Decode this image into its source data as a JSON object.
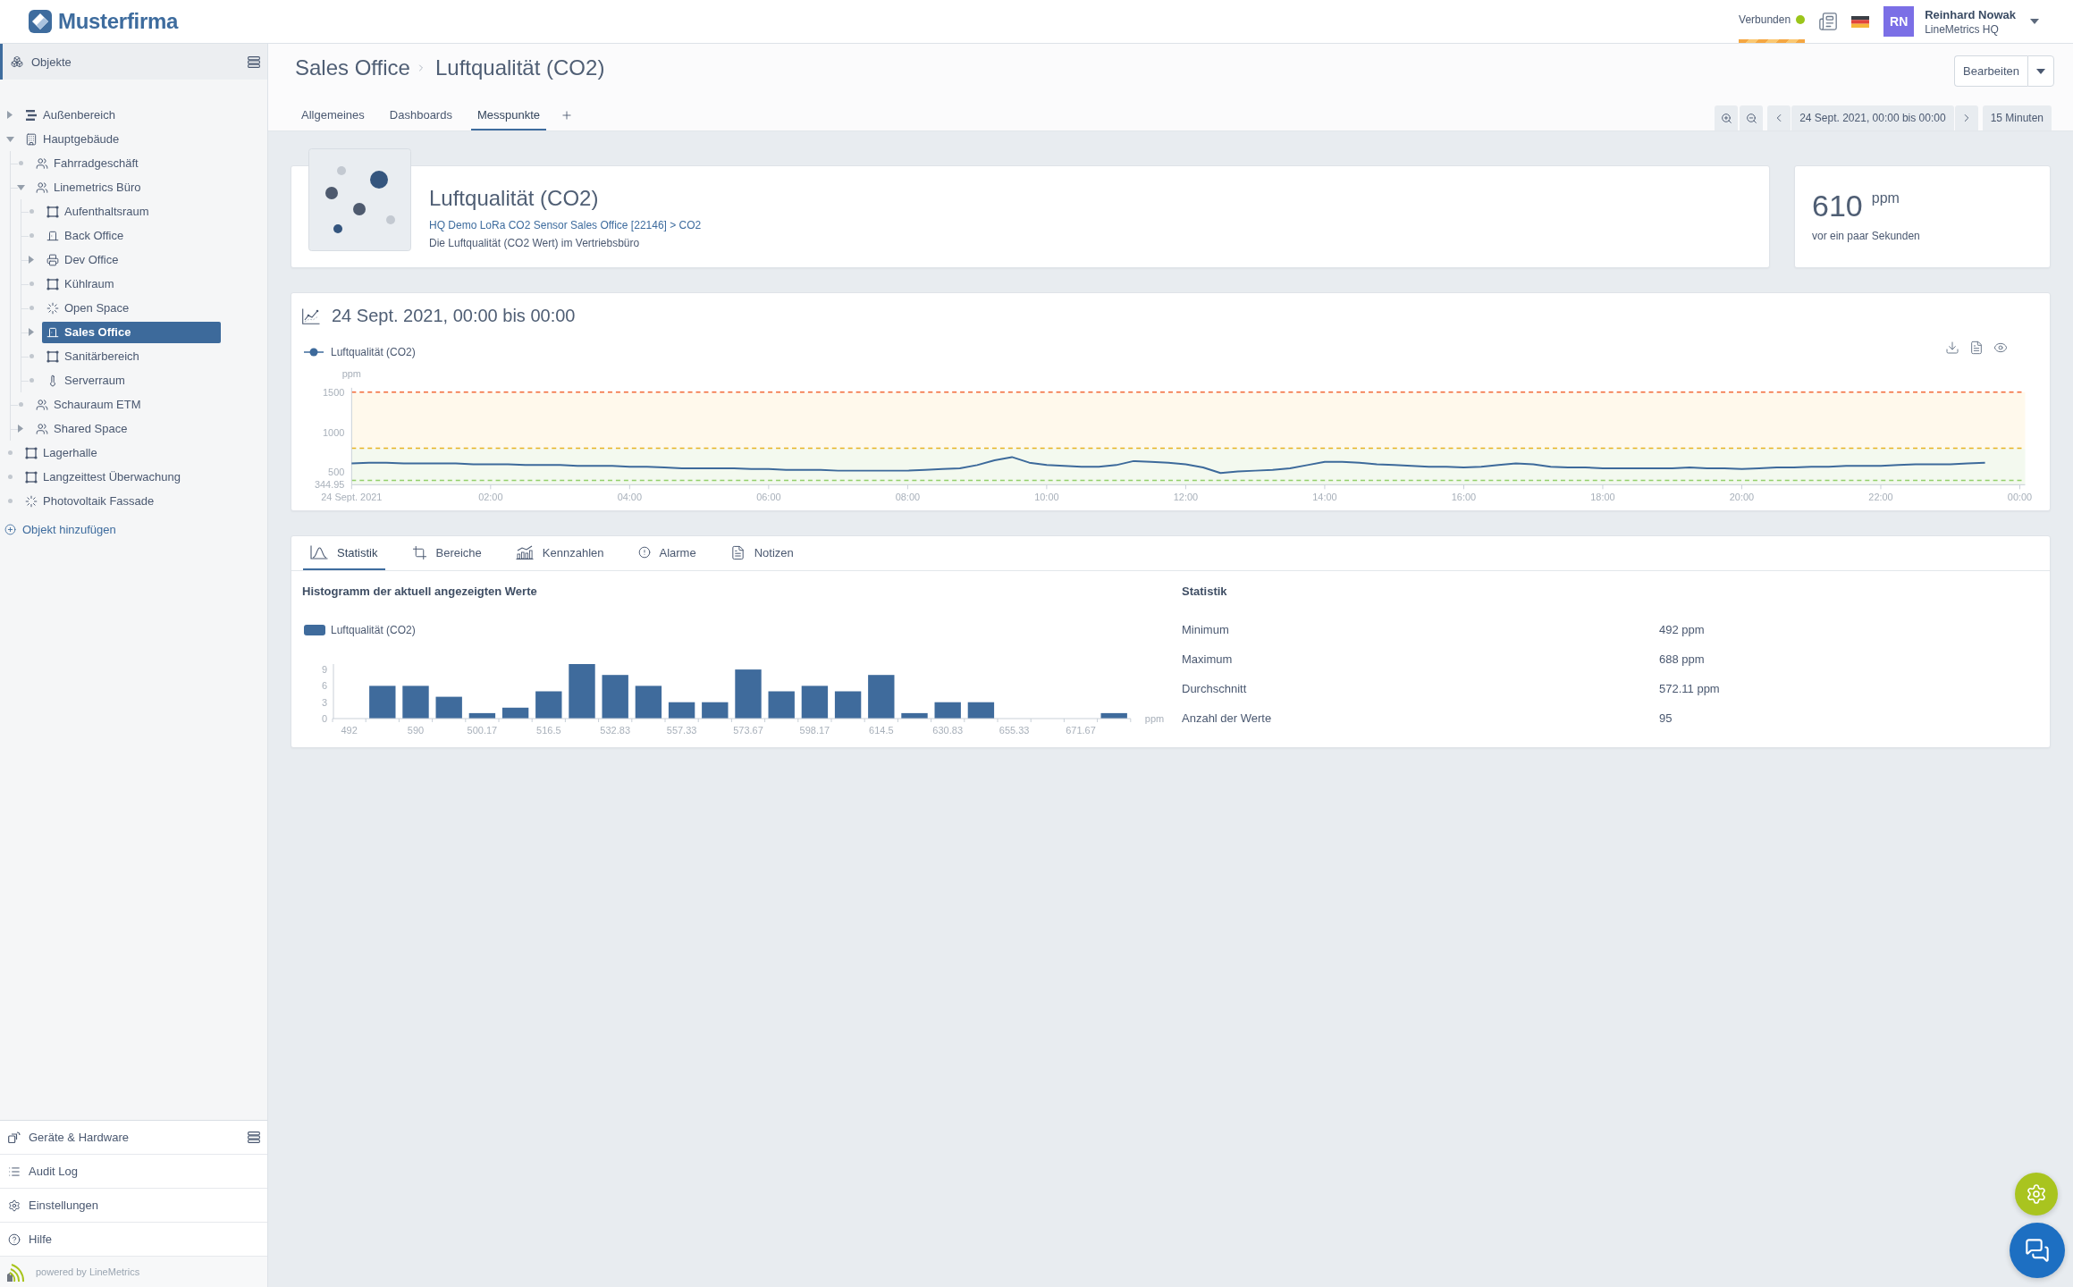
{
  "topbar": {
    "logo": "Musterfirma",
    "status": {
      "label": "Verbunden",
      "connected": true
    },
    "user": {
      "initials": "RN",
      "name": "Reinhard Nowak",
      "org": "LineMetrics HQ"
    }
  },
  "sidebar": {
    "section": "Objekte",
    "tree": [
      {
        "label": "Außenbereich",
        "kind": "zone",
        "leaf": false,
        "expanded": false,
        "selected": false
      },
      {
        "label": "Hauptgebäude",
        "kind": "building",
        "leaf": false,
        "expanded": true,
        "selected": false,
        "children": [
          {
            "label": "Fahrradgeschäft",
            "kind": "team",
            "leaf": true,
            "expanded": false,
            "selected": false
          },
          {
            "label": "Linemetrics Büro",
            "kind": "team",
            "leaf": false,
            "expanded": true,
            "selected": false,
            "children": [
              {
                "label": "Aufenthaltsraum",
                "kind": "room",
                "leaf": true,
                "expanded": false,
                "selected": false
              },
              {
                "label": "Back Office",
                "kind": "door",
                "leaf": true,
                "expanded": false,
                "selected": false
              },
              {
                "label": "Dev Office",
                "kind": "machine",
                "leaf": false,
                "expanded": false,
                "selected": false
              },
              {
                "label": "Kühlraum",
                "kind": "room",
                "leaf": true,
                "expanded": false,
                "selected": false
              },
              {
                "label": "Open Space",
                "kind": "sun",
                "leaf": true,
                "expanded": false,
                "selected": false
              },
              {
                "label": "Sales Office",
                "kind": "door",
                "leaf": false,
                "expanded": false,
                "selected": true
              },
              {
                "label": "Sanitärbereich",
                "kind": "room",
                "leaf": true,
                "expanded": false,
                "selected": false
              },
              {
                "label": "Serverraum",
                "kind": "thermometer",
                "leaf": true,
                "expanded": false,
                "selected": false
              }
            ]
          },
          {
            "label": "Schauraum ETM",
            "kind": "team",
            "leaf": true,
            "expanded": false,
            "selected": false
          },
          {
            "label": "Shared Space",
            "kind": "team",
            "leaf": false,
            "expanded": false,
            "selected": false
          }
        ]
      },
      {
        "label": "Lagerhalle",
        "kind": "room",
        "leaf": true,
        "expanded": false,
        "selected": false
      },
      {
        "label": "Langzeittest Überwachung",
        "kind": "room",
        "leaf": true,
        "expanded": false,
        "selected": false
      },
      {
        "label": "Photovoltaik Fassade",
        "kind": "sun",
        "leaf": true,
        "expanded": false,
        "selected": false
      }
    ],
    "add_label": "Objekt hinzufügen",
    "nav": [
      {
        "kind": "devices",
        "label": "Geräte & Hardware",
        "menu": true
      },
      {
        "kind": "log",
        "label": "Audit Log",
        "menu": false
      },
      {
        "kind": "settings",
        "label": "Einstellungen",
        "menu": false
      },
      {
        "kind": "help",
        "label": "Hilfe",
        "menu": false
      }
    ],
    "footer": "powered by LineMetrics"
  },
  "page": {
    "breadcrumb": {
      "parent": "Sales Office",
      "current": "Luftqualität (CO2)"
    },
    "edit_button": "Bearbeiten",
    "tabs": [
      {
        "label": "Allgemeines",
        "selected": false
      },
      {
        "label": "Dashboards",
        "selected": false
      },
      {
        "label": "Messpunkte",
        "selected": true
      }
    ],
    "timebar": {
      "range": "24 Sept. 2021, 00:00 bis 00:00",
      "interval": "15 Minuten"
    }
  },
  "datapoint": {
    "title": "Luftqualität (CO2)",
    "source": "HQ Demo LoRa CO2 Sensor Sales Office [22146] > CO2",
    "description": "Die Luftqualität (CO2 Wert) im Vertriebsbüro"
  },
  "current_value": {
    "value": "610",
    "unit": "ppm",
    "age": "vor ein paar Sekunden"
  },
  "trend": {
    "chart_data": {
      "type": "line",
      "title": "24 Sept. 2021, 00:00 bis 00:00",
      "ylabel": "ppm",
      "x": [
        0,
        0.25,
        0.5,
        0.75,
        1,
        1.25,
        1.5,
        1.75,
        2,
        2.25,
        2.5,
        2.75,
        3,
        3.25,
        3.5,
        3.75,
        4,
        4.25,
        4.5,
        4.75,
        5,
        5.25,
        5.5,
        5.75,
        6,
        6.25,
        6.5,
        6.75,
        7,
        7.25,
        7.5,
        7.75,
        8,
        8.25,
        8.5,
        8.75,
        9,
        9.25,
        9.5,
        9.75,
        10,
        10.25,
        10.5,
        10.75,
        11,
        11.25,
        11.5,
        11.75,
        12,
        12.25,
        12.5,
        12.75,
        13,
        13.25,
        13.5,
        13.75,
        14,
        14.25,
        14.5,
        14.75,
        15,
        15.25,
        15.5,
        15.75,
        16,
        16.25,
        16.5,
        16.75,
        17,
        17.25,
        17.5,
        17.75,
        18,
        18.25,
        18.5,
        18.75,
        19,
        19.25,
        19.5,
        19.75,
        20,
        20.25,
        20.5,
        20.75,
        21,
        21.25,
        21.5,
        21.75,
        22,
        22.25,
        22.5,
        22.75,
        23,
        23.25,
        23.5
      ],
      "series": [
        {
          "name": "Luftqualität (CO2)",
          "color": "#3d6a9b",
          "values": [
            610,
            620,
            620,
            610,
            610,
            610,
            610,
            600,
            600,
            600,
            590,
            590,
            590,
            580,
            580,
            580,
            570,
            570,
            560,
            550,
            550,
            550,
            550,
            540,
            540,
            530,
            530,
            530,
            520,
            520,
            520,
            520,
            520,
            530,
            540,
            550,
            590,
            650,
            690,
            620,
            590,
            580,
            570,
            570,
            590,
            640,
            630,
            620,
            600,
            560,
            490,
            510,
            520,
            530,
            550,
            590,
            630,
            630,
            620,
            600,
            590,
            580,
            570,
            570,
            560,
            570,
            590,
            610,
            600,
            570,
            560,
            560,
            550,
            550,
            550,
            550,
            550,
            560,
            550,
            550,
            540,
            550,
            560,
            560,
            570,
            570,
            580,
            580,
            580,
            590,
            600,
            600,
            600,
            610,
            620
          ]
        }
      ],
      "xlim": [
        0,
        24
      ],
      "ylim": [
        344.95,
        1500
      ],
      "xticks": [
        {
          "value": 0,
          "label": "24 Sept. 2021"
        },
        {
          "value": 2,
          "label": "02:00"
        },
        {
          "value": 4,
          "label": "04:00"
        },
        {
          "value": 6,
          "label": "06:00"
        },
        {
          "value": 8,
          "label": "08:00"
        },
        {
          "value": 10,
          "label": "10:00"
        },
        {
          "value": 12,
          "label": "12:00"
        },
        {
          "value": 14,
          "label": "14:00"
        },
        {
          "value": 16,
          "label": "16:00"
        },
        {
          "value": 18,
          "label": "18:00"
        },
        {
          "value": 20,
          "label": "20:00"
        },
        {
          "value": 22,
          "label": "22:00"
        },
        {
          "value": 24,
          "label": "00:00"
        }
      ],
      "yticks": [
        {
          "value": 344.95,
          "label": "344.95"
        },
        500,
        1000,
        1500
      ],
      "bands": [
        {
          "axis": "y",
          "from": 800,
          "to": 1500,
          "color": "#fff9ec"
        },
        {
          "axis": "y",
          "from": 344.95,
          "to": 800,
          "color": "#f3f9ef"
        }
      ],
      "ref_lines": [
        {
          "axis": "y",
          "value": 1500,
          "color": "#f26b3a"
        },
        {
          "axis": "y",
          "value": 800,
          "color": "#e6b422"
        },
        {
          "axis": "y",
          "value": 400,
          "color": "#93d06a"
        }
      ]
    }
  },
  "analysis": {
    "tabs": [
      {
        "label": "Statistik",
        "kind": "stats",
        "selected": true
      },
      {
        "label": "Bereiche",
        "kind": "ranges",
        "selected": false
      },
      {
        "label": "Kennzahlen",
        "kind": "kpis",
        "selected": false
      },
      {
        "label": "Alarme",
        "kind": "alarms",
        "selected": false
      },
      {
        "label": "Notizen",
        "kind": "notes",
        "selected": false
      }
    ],
    "histogram": {
      "chart_data": {
        "type": "bar",
        "title": "Histogramm der aktuell angezeigten Werte",
        "xlabel": "ppm",
        "categories": [
          "492",
          null,
          "590",
          null,
          "500.17",
          null,
          "516.5",
          null,
          "532.83",
          null,
          "557.33",
          null,
          "573.67",
          null,
          "598.17",
          null,
          "614.5",
          null,
          "630.83",
          null,
          "655.33",
          null,
          "671.67",
          null
        ],
        "series": [
          {
            "name": "Luftqualität (CO2)",
            "color": "#3f6b9c",
            "values": [
              0,
              6,
              6,
              4,
              1,
              2,
              5,
              10,
              8,
              6,
              3,
              3,
              9,
              5,
              6,
              5,
              8,
              1,
              3,
              3,
              0,
              0,
              0,
              1
            ]
          }
        ],
        "ylim": [
          0,
          10
        ],
        "yticks": [
          0,
          3,
          6,
          9
        ]
      }
    },
    "statistics": {
      "title": "Statistik",
      "rows": [
        {
          "label": "Minimum",
          "value": "492 ppm"
        },
        {
          "label": "Maximum",
          "value": "688 ppm"
        },
        {
          "label": "Durchschnitt",
          "value": "572.11 ppm"
        },
        {
          "label": "Anzahl der Werte",
          "value": "95"
        }
      ]
    }
  }
}
